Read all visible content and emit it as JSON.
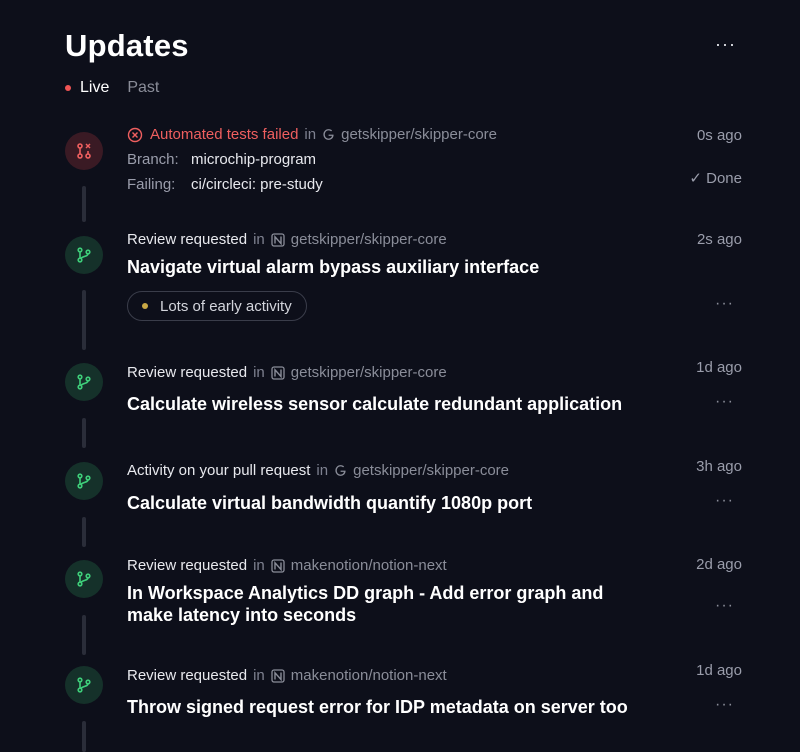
{
  "header": {
    "title": "Updates",
    "menu": "···"
  },
  "tabs": {
    "live": "Live",
    "past": "Past"
  },
  "items": [
    {
      "event": "Automated tests failed",
      "in": "in",
      "repo": "getskipper/skipper-core",
      "repo_icon": "google-icon",
      "time": "0s ago",
      "branch_label": "Branch:",
      "branch_value": "microchip-program",
      "failing_label": "Failing:",
      "failing_value": "ci/circleci: pre-study",
      "done": "✓ Done"
    },
    {
      "event": "Review requested",
      "in": "in",
      "repo": "getskipper/skipper-core",
      "repo_icon": "notion-icon",
      "time": "2s ago",
      "title": "Navigate virtual alarm bypass auxiliary interface",
      "chip": "Lots of early activity",
      "menu": "···"
    },
    {
      "event": "Review requested",
      "in": "in",
      "repo": "getskipper/skipper-core",
      "repo_icon": "notion-icon",
      "time": "1d ago",
      "title": "Calculate wireless sensor calculate redundant application",
      "menu": "···"
    },
    {
      "event": "Activity on your pull request",
      "in": "in",
      "repo": "getskipper/skipper-core",
      "repo_icon": "google-icon",
      "time": "3h ago",
      "title": "Calculate virtual bandwidth quantify 1080p port",
      "menu": "···"
    },
    {
      "event": "Review requested",
      "in": "in",
      "repo": "makenotion/notion-next",
      "repo_icon": "notion-icon",
      "time": "2d ago",
      "title_line1": "In Workspace Analytics DD graph - Add error graph and",
      "title_line2": "make latency into seconds",
      "menu": "···"
    },
    {
      "event": "Review requested",
      "in": "in",
      "repo": "makenotion/notion-next",
      "repo_icon": "notion-icon",
      "time": "1d ago",
      "title": "Throw signed request error for IDP metadata on server too",
      "menu": "···"
    }
  ],
  "colors": {
    "background": "#0d0f1a",
    "failed": "#ef5f5f",
    "success": "#3ecf7a",
    "live_dot": "#ef5454",
    "chip_dot": "#c9a845"
  }
}
